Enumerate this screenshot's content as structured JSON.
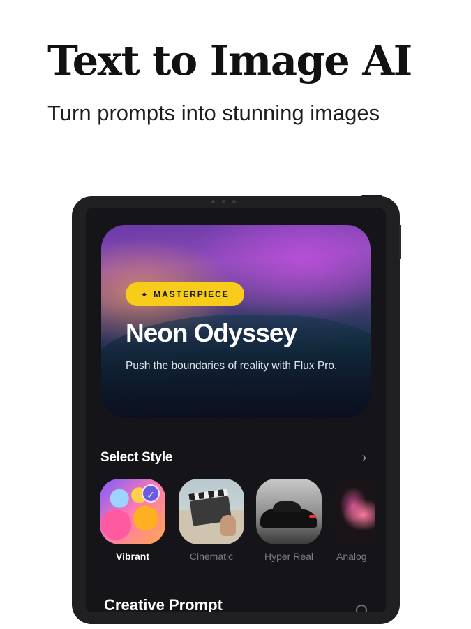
{
  "header": {
    "title": "Text to Image AI",
    "subtitle": "Turn prompts into stunning images"
  },
  "hero": {
    "badge_icon": "sparkle-icon",
    "badge_label": "MASTERPIECE",
    "title": "Neon Odyssey",
    "description": "Push the boundaries of reality with Flux Pro."
  },
  "styles_section": {
    "title": "Select Style",
    "arrow": "›",
    "items": [
      {
        "label": "Vibrant",
        "selected": true
      },
      {
        "label": "Cinematic",
        "selected": false
      },
      {
        "label": "Hyper Real",
        "selected": false
      },
      {
        "label": "Analog",
        "selected": false
      }
    ],
    "check_mark": "✓"
  },
  "creative_section": {
    "title": "Creative Prompt"
  },
  "colors": {
    "badge": "#f7cc1b",
    "screen_bg": "#151418",
    "selected_check": "#6a5be0"
  }
}
